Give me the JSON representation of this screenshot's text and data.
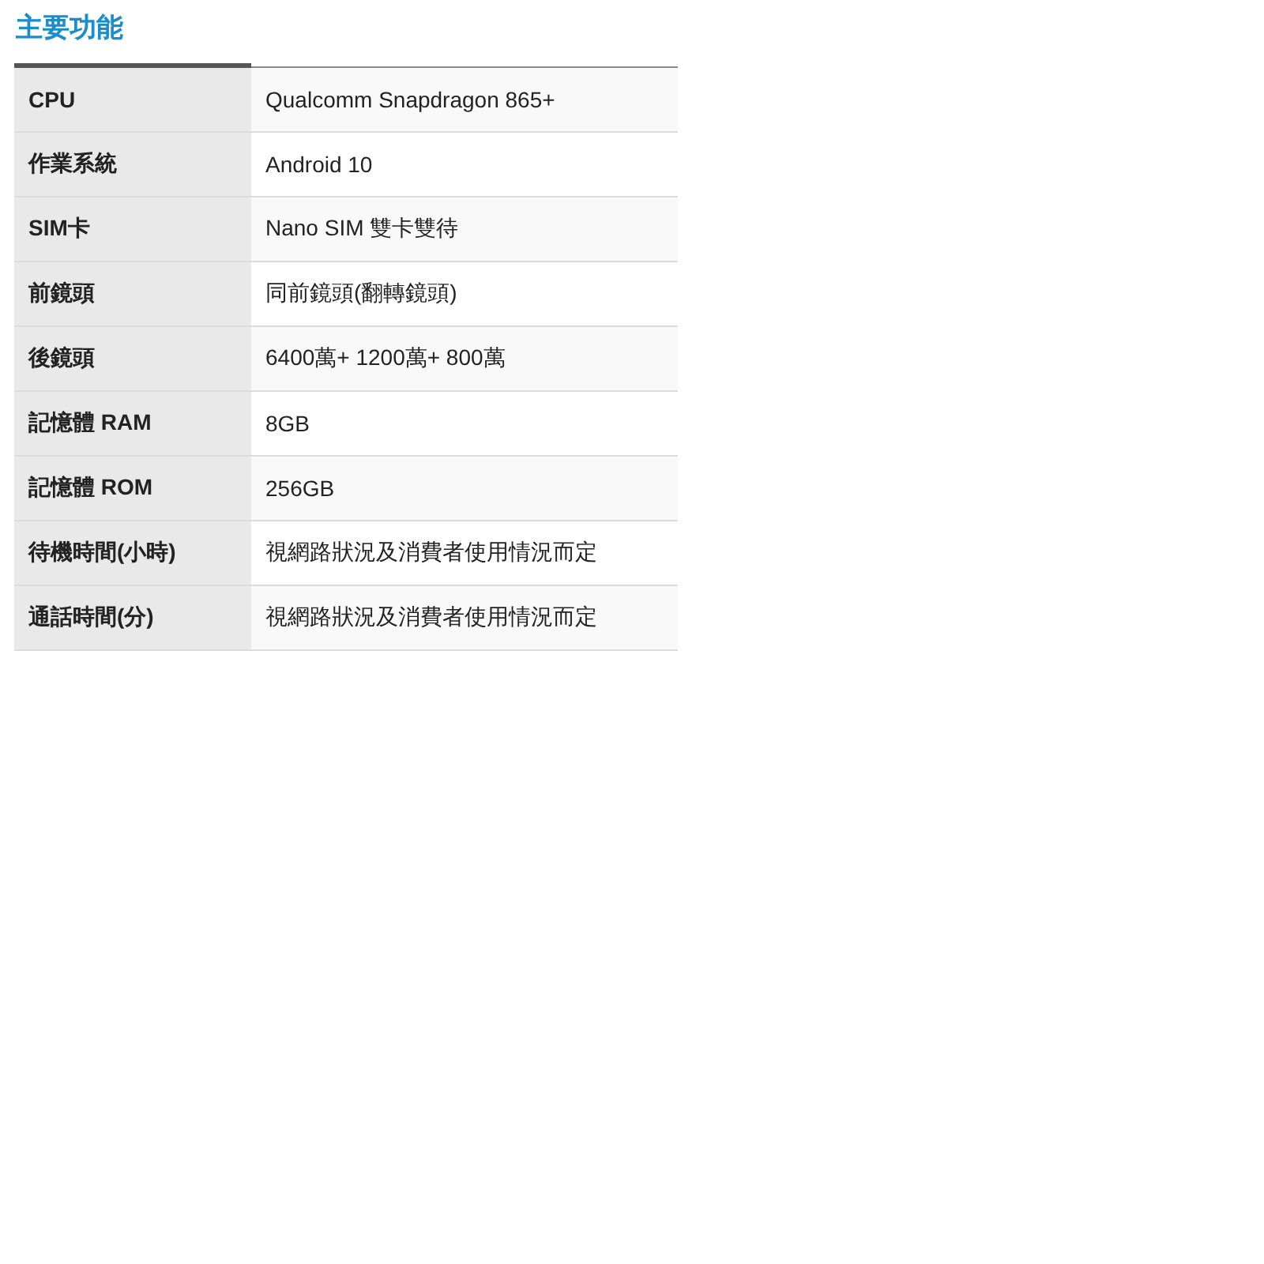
{
  "heading": "主要功能",
  "rows": [
    {
      "label": "CPU",
      "value": "Qualcomm Snapdragon 865+"
    },
    {
      "label": "作業系統",
      "value": "Android 10"
    },
    {
      "label": "SIM卡",
      "value": "Nano SIM 雙卡雙待"
    },
    {
      "label": "前鏡頭",
      "value": "同前鏡頭(翻轉鏡頭)"
    },
    {
      "label": "後鏡頭",
      "value": "6400萬+ 1200萬+ 800萬"
    },
    {
      "label": "記憶體 RAM",
      "value": "8GB"
    },
    {
      "label": "記憶體 ROM",
      "value": "256GB"
    },
    {
      "label": "待機時間(小時)",
      "value": "視網路狀況及消費者使用情況而定"
    },
    {
      "label": "通話時間(分)",
      "value": "視網路狀況及消費者使用情況而定"
    }
  ]
}
